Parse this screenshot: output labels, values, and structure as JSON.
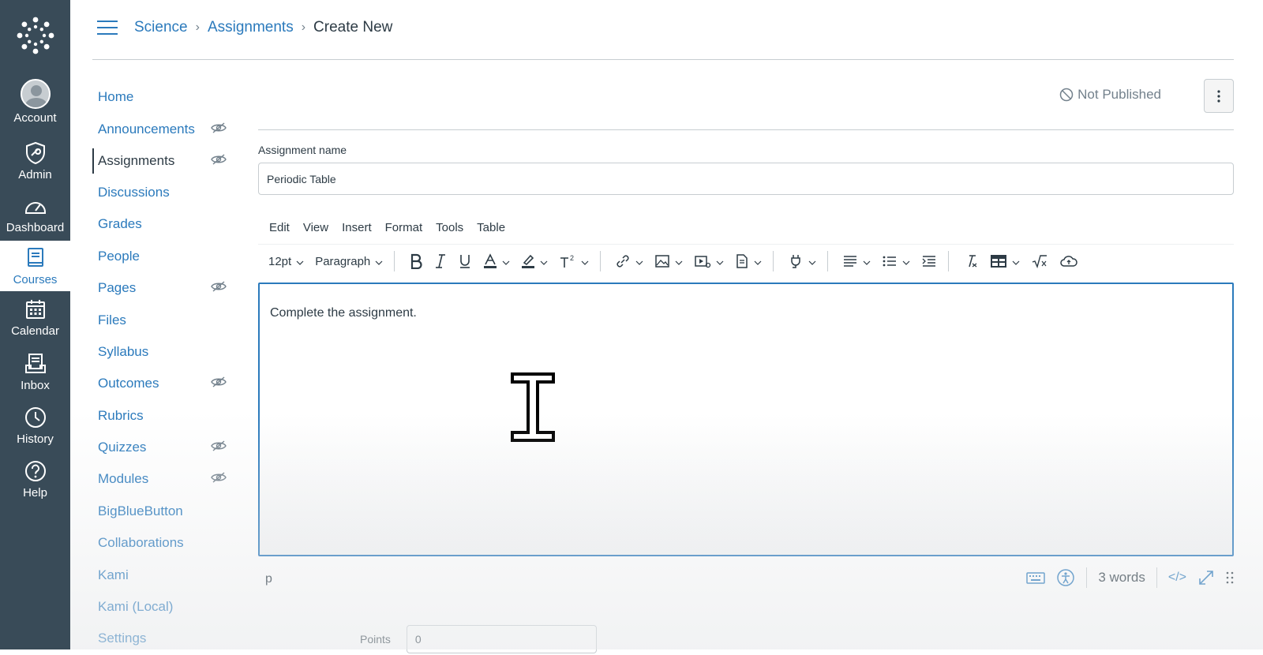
{
  "global_nav": {
    "items": [
      {
        "label": "Account",
        "icon": "avatar"
      },
      {
        "label": "Admin",
        "icon": "shield-icon"
      },
      {
        "label": "Dashboard",
        "icon": "speedometer-icon"
      },
      {
        "label": "Courses",
        "icon": "book-icon",
        "active": true
      },
      {
        "label": "Calendar",
        "icon": "calendar-icon"
      },
      {
        "label": "Inbox",
        "icon": "inbox-icon"
      },
      {
        "label": "History",
        "icon": "clock-icon"
      },
      {
        "label": "Help",
        "icon": "help-icon"
      }
    ]
  },
  "breadcrumb": {
    "course": "Science",
    "section": "Assignments",
    "current": "Create New"
  },
  "course_nav": {
    "items": [
      {
        "label": "Home",
        "hidden": false
      },
      {
        "label": "Announcements",
        "hidden": true
      },
      {
        "label": "Assignments",
        "hidden": true,
        "active": true
      },
      {
        "label": "Discussions",
        "hidden": false
      },
      {
        "label": "Grades",
        "hidden": false
      },
      {
        "label": "People",
        "hidden": false
      },
      {
        "label": "Pages",
        "hidden": true
      },
      {
        "label": "Files",
        "hidden": false
      },
      {
        "label": "Syllabus",
        "hidden": false
      },
      {
        "label": "Outcomes",
        "hidden": true
      },
      {
        "label": "Rubrics",
        "hidden": false
      },
      {
        "label": "Quizzes",
        "hidden": true
      },
      {
        "label": "Modules",
        "hidden": true
      },
      {
        "label": "BigBlueButton",
        "hidden": false
      },
      {
        "label": "Collaborations",
        "hidden": false
      },
      {
        "label": "Kami",
        "hidden": false
      },
      {
        "label": "Kami (Local)",
        "hidden": false
      },
      {
        "label": "Settings",
        "hidden": false
      }
    ]
  },
  "publish": {
    "status": "Not Published"
  },
  "assignment": {
    "name_label": "Assignment name",
    "name_value": "Periodic Table",
    "points_label": "Points",
    "points_value": "0"
  },
  "editor": {
    "menu": [
      "Edit",
      "View",
      "Insert",
      "Format",
      "Tools",
      "Table"
    ],
    "font_size": "12pt",
    "block_format": "Paragraph",
    "content": "Complete the assignment.",
    "path": "p",
    "word_count": "3 words",
    "html_toggle": "</>"
  },
  "colors": {
    "nav_bg": "#394b58",
    "link": "#2b7abc",
    "text": "#2d3b45",
    "muted": "#73818c",
    "border": "#c7cdd1"
  }
}
